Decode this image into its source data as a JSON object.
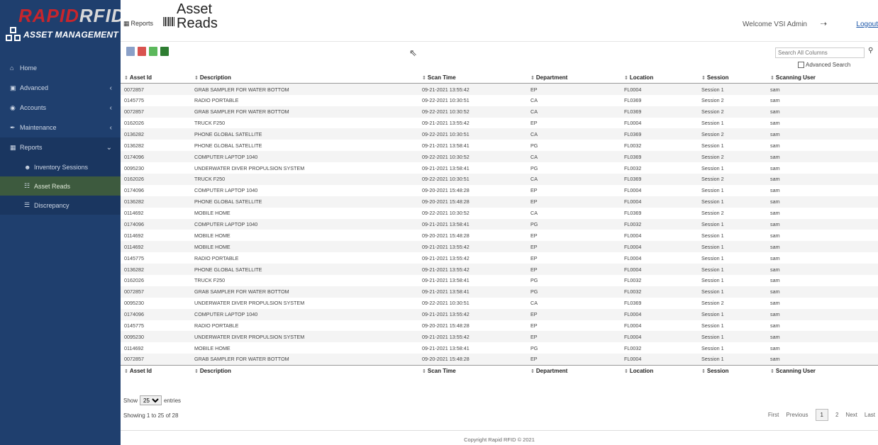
{
  "brand": {
    "rapid": "RAPID",
    "rfid": "RFID",
    "subtitle": "ASSET MANAGEMENT"
  },
  "sidebar": {
    "items": [
      {
        "label": "Home",
        "icon": "home-icon"
      },
      {
        "label": "Advanced",
        "icon": "plus-square-icon"
      },
      {
        "label": "Accounts",
        "icon": "user-icon"
      },
      {
        "label": "Maintenance",
        "icon": "wrench-icon"
      },
      {
        "label": "Reports",
        "icon": "bank-icon"
      }
    ],
    "subitems": [
      {
        "label": "Inventory Sessions",
        "icon": "users-icon"
      },
      {
        "label": "Asset Reads",
        "icon": "barcode-icon"
      },
      {
        "label": "Discrepancy",
        "icon": "list-icon"
      }
    ]
  },
  "header": {
    "breadcrumb": "Reports",
    "title_line1": "Asset",
    "title_line2": "Reads",
    "welcome": "Welcome VSI Admin",
    "logout": "Logout"
  },
  "search": {
    "placeholder": "Search All Columns",
    "advanced_label": "Advanced Search"
  },
  "table": {
    "columns": [
      "Asset Id",
      "Description",
      "Scan Time",
      "Department",
      "Location",
      "Session",
      "Scanning User"
    ],
    "rows": [
      [
        "0072857",
        "GRAB SAMPLER FOR WATER BOTTOM",
        "09-21-2021 13:55:42",
        "EP",
        "FL0004",
        "Session 1",
        "sam"
      ],
      [
        "0145775",
        "RADIO PORTABLE",
        "09-22-2021 10:30:51",
        "CA",
        "FL0369",
        "Session 2",
        "sam"
      ],
      [
        "0072857",
        "GRAB SAMPLER FOR WATER BOTTOM",
        "09-22-2021 10:30:52",
        "CA",
        "FL0369",
        "Session 2",
        "sam"
      ],
      [
        "0162026",
        "TRUCK F250",
        "09-21-2021 13:55:42",
        "EP",
        "FL0004",
        "Session 1",
        "sam"
      ],
      [
        "0136282",
        "PHONE GLOBAL SATELLITE",
        "09-22-2021 10:30:51",
        "CA",
        "FL0369",
        "Session 2",
        "sam"
      ],
      [
        "0136282",
        "PHONE GLOBAL SATELLITE",
        "09-21-2021 13:58:41",
        "PG",
        "FL0032",
        "Session 1",
        "sam"
      ],
      [
        "0174096",
        "COMPUTER LAPTOP 1040",
        "09-22-2021 10:30:52",
        "CA",
        "FL0369",
        "Session 2",
        "sam"
      ],
      [
        "0095230",
        "UNDERWATER DIVER PROPULSION SYSTEM",
        "09-21-2021 13:58:41",
        "PG",
        "FL0032",
        "Session 1",
        "sam"
      ],
      [
        "0162026",
        "TRUCK F250",
        "09-22-2021 10:30:51",
        "CA",
        "FL0369",
        "Session 2",
        "sam"
      ],
      [
        "0174096",
        "COMPUTER LAPTOP 1040",
        "09-20-2021 15:48:28",
        "EP",
        "FL0004",
        "Session 1",
        "sam"
      ],
      [
        "0136282",
        "PHONE GLOBAL SATELLITE",
        "09-20-2021 15:48:28",
        "EP",
        "FL0004",
        "Session 1",
        "sam"
      ],
      [
        "0114692",
        "MOBILE HOME",
        "09-22-2021 10:30:52",
        "CA",
        "FL0369",
        "Session 2",
        "sam"
      ],
      [
        "0174096",
        "COMPUTER LAPTOP 1040",
        "09-21-2021 13:58:41",
        "PG",
        "FL0032",
        "Session 1",
        "sam"
      ],
      [
        "0114692",
        "MOBILE HOME",
        "09-20-2021 15:48:28",
        "EP",
        "FL0004",
        "Session 1",
        "sam"
      ],
      [
        "0114692",
        "MOBILE HOME",
        "09-21-2021 13:55:42",
        "EP",
        "FL0004",
        "Session 1",
        "sam"
      ],
      [
        "0145775",
        "RADIO PORTABLE",
        "09-21-2021 13:55:42",
        "EP",
        "FL0004",
        "Session 1",
        "sam"
      ],
      [
        "0136282",
        "PHONE GLOBAL SATELLITE",
        "09-21-2021 13:55:42",
        "EP",
        "FL0004",
        "Session 1",
        "sam"
      ],
      [
        "0162026",
        "TRUCK F250",
        "09-21-2021 13:58:41",
        "PG",
        "FL0032",
        "Session 1",
        "sam"
      ],
      [
        "0072857",
        "GRAB SAMPLER FOR WATER BOTTOM",
        "09-21-2021 13:58:41",
        "PG",
        "FL0032",
        "Session 1",
        "sam"
      ],
      [
        "0095230",
        "UNDERWATER DIVER PROPULSION SYSTEM",
        "09-22-2021 10:30:51",
        "CA",
        "FL0369",
        "Session 2",
        "sam"
      ],
      [
        "0174096",
        "COMPUTER LAPTOP 1040",
        "09-21-2021 13:55:42",
        "EP",
        "FL0004",
        "Session 1",
        "sam"
      ],
      [
        "0145775",
        "RADIO PORTABLE",
        "09-20-2021 15:48:28",
        "EP",
        "FL0004",
        "Session 1",
        "sam"
      ],
      [
        "0095230",
        "UNDERWATER DIVER PROPULSION SYSTEM",
        "09-21-2021 13:55:42",
        "EP",
        "FL0004",
        "Session 1",
        "sam"
      ],
      [
        "0114692",
        "MOBILE HOME",
        "09-21-2021 13:58:41",
        "PG",
        "FL0032",
        "Session 1",
        "sam"
      ],
      [
        "0072857",
        "GRAB SAMPLER FOR WATER BOTTOM",
        "09-20-2021 15:48:28",
        "EP",
        "FL0004",
        "Session 1",
        "sam"
      ]
    ]
  },
  "footer": {
    "show_label": "Show",
    "page_size": "25",
    "entries_label": "entries",
    "showing": "Showing 1 to 25 of 28",
    "pager": {
      "first": "First",
      "previous": "Previous",
      "page1": "1",
      "page2": "2",
      "next": "Next",
      "last": "Last"
    },
    "copyright": "Copyright Rapid RFID © 2021"
  }
}
